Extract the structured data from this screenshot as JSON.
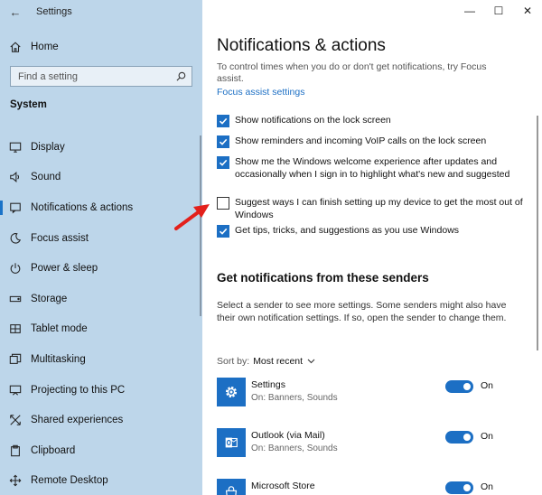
{
  "window": {
    "title": "Settings",
    "back_glyph": "←",
    "minimize_glyph": "—",
    "maximize_glyph": "☐",
    "close_glyph": "✕"
  },
  "sidebar": {
    "home_label": "Home",
    "search_placeholder": "Find a setting",
    "section_title": "System",
    "items": [
      {
        "label": "Display",
        "icon": "display-icon"
      },
      {
        "label": "Sound",
        "icon": "sound-icon"
      },
      {
        "label": "Notifications & actions",
        "icon": "notifications-icon",
        "active": true
      },
      {
        "label": "Focus assist",
        "icon": "focus-assist-icon"
      },
      {
        "label": "Power & sleep",
        "icon": "power-icon"
      },
      {
        "label": "Storage",
        "icon": "storage-icon"
      },
      {
        "label": "Tablet mode",
        "icon": "tablet-icon"
      },
      {
        "label": "Multitasking",
        "icon": "multitasking-icon"
      },
      {
        "label": "Projecting to this PC",
        "icon": "projecting-icon"
      },
      {
        "label": "Shared experiences",
        "icon": "shared-icon"
      },
      {
        "label": "Clipboard",
        "icon": "clipboard-icon"
      },
      {
        "label": "Remote Desktop",
        "icon": "remote-desktop-icon"
      }
    ]
  },
  "main": {
    "title": "Notifications & actions",
    "intro": "To control times when you do or don't get notifications, try Focus assist.",
    "focus_link": "Focus assist settings",
    "options": [
      {
        "label": "Show notifications on the lock screen",
        "checked": true
      },
      {
        "label": "Show reminders and incoming VoIP calls on the lock screen",
        "checked": true
      },
      {
        "label": "Show me the Windows welcome experience after updates and occasionally when I sign in to highlight what's new and suggested",
        "checked": true
      },
      {
        "label": "Suggest ways I can finish setting up my device to get the most out of Windows",
        "checked": false
      },
      {
        "label": "Get tips, tricks, and suggestions as you use Windows",
        "checked": true
      }
    ],
    "senders_heading": "Get notifications from these senders",
    "senders_desc": "Select a sender to see more settings. Some senders might also have their own notification settings. If so, open the sender to change them.",
    "sort_label": "Sort by:",
    "sort_value": "Most recent",
    "senders": [
      {
        "name": "Settings",
        "sub": "On: Banners, Sounds",
        "state": "On",
        "icon": "gear-icon"
      },
      {
        "name": "Outlook (via Mail)",
        "sub": "On: Banners, Sounds",
        "state": "On",
        "icon": "outlook-icon"
      },
      {
        "name": "Microsoft Store",
        "sub": "",
        "state": "On",
        "icon": "store-icon"
      }
    ]
  },
  "colors": {
    "accent": "#1c6fc4",
    "sidebar_bg": "#bdd6ea",
    "annotation_arrow": "#e3201b"
  }
}
